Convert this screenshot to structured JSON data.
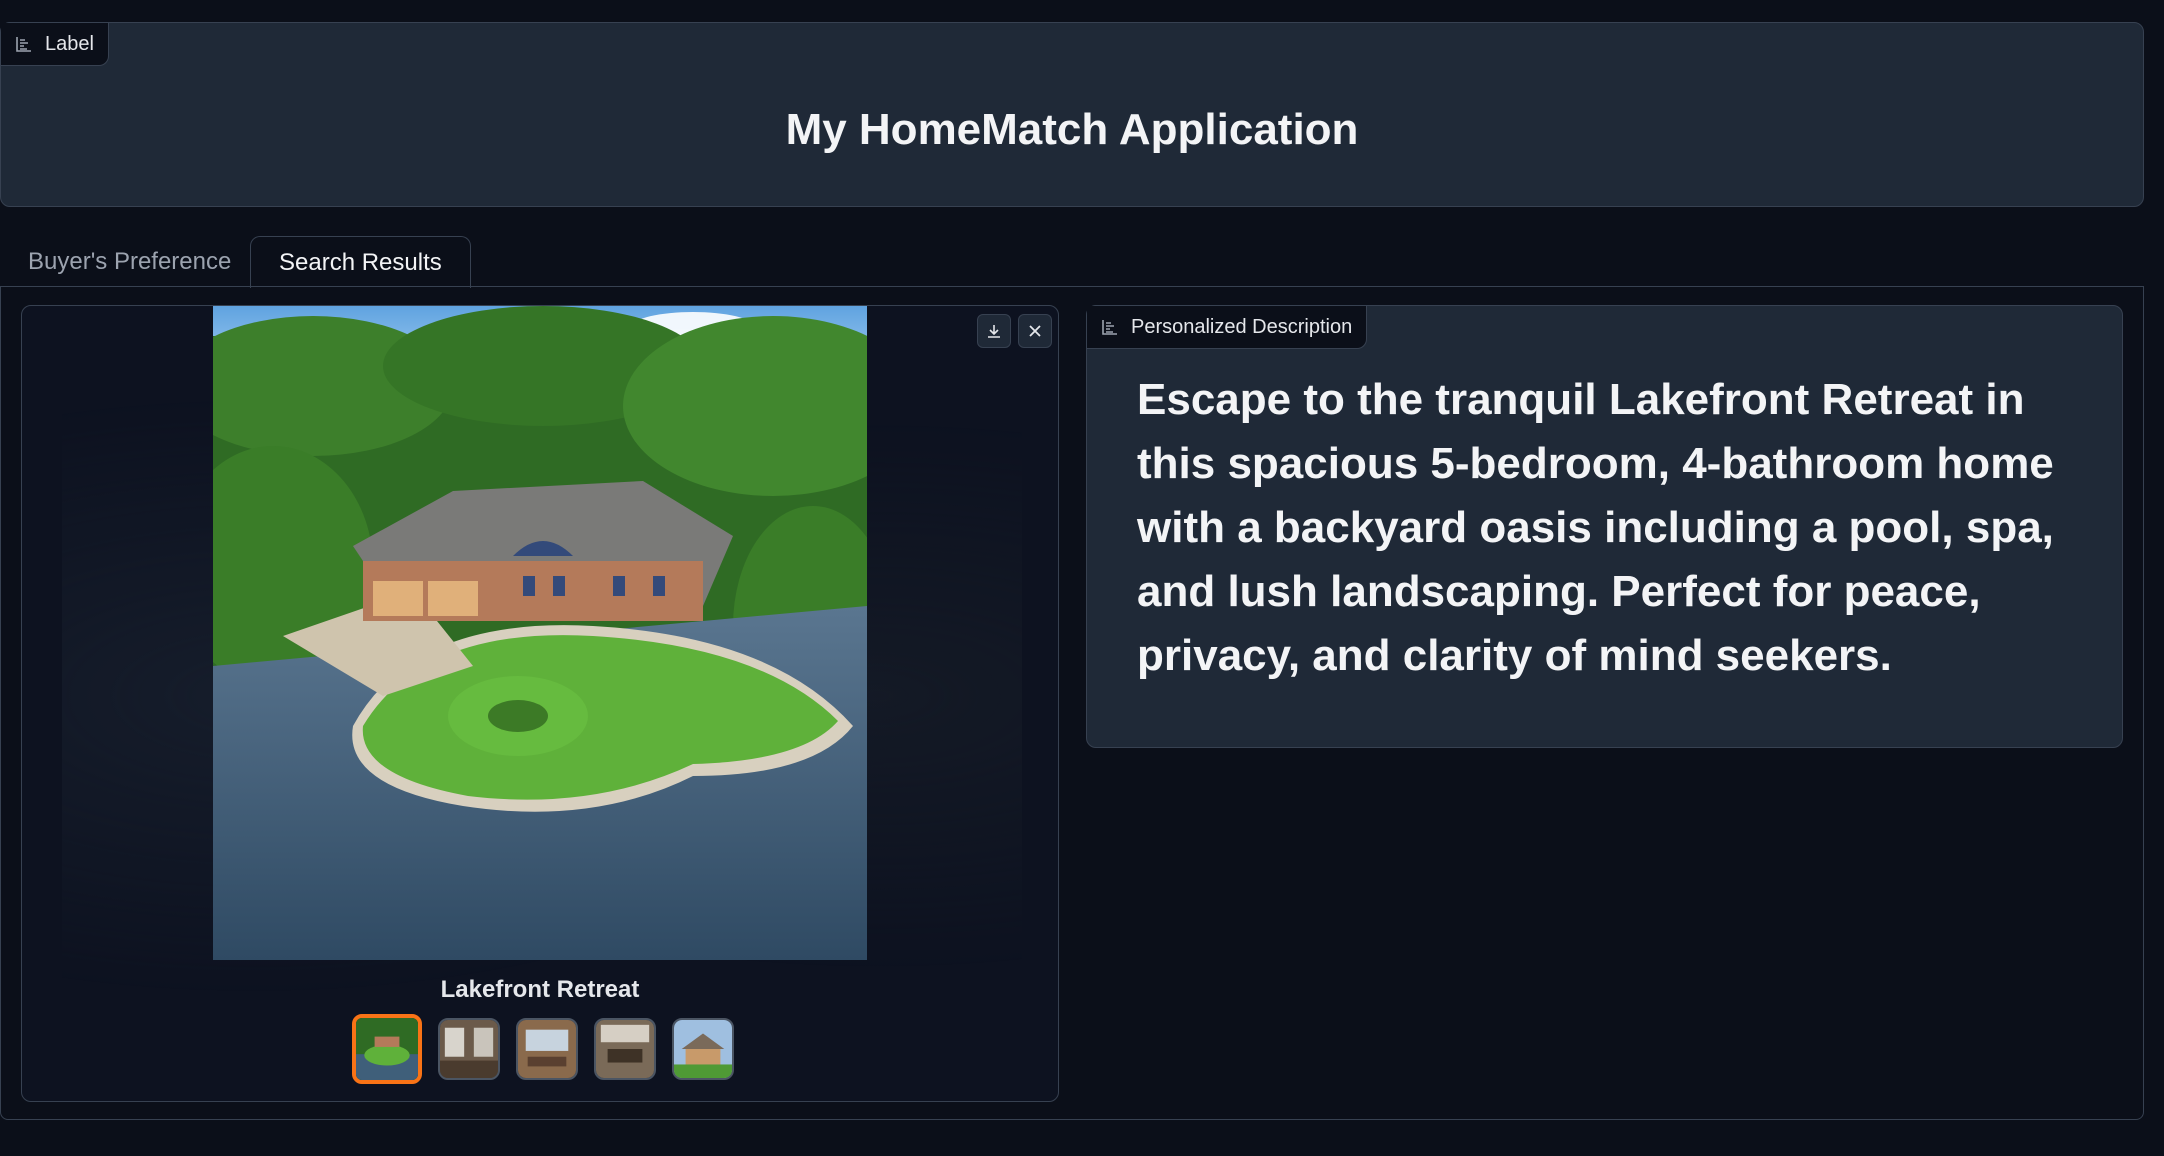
{
  "header": {
    "tag_label": "Label",
    "title": "My HomeMatch Application"
  },
  "tabs": [
    {
      "label": "Buyer's Preference",
      "active": false
    },
    {
      "label": "Search Results",
      "active": true
    }
  ],
  "gallery": {
    "caption": "Lakefront Retreat",
    "download_icon": "download-icon",
    "close_icon": "close-icon",
    "thumbnails": [
      "Lakefront Retreat exterior",
      "interior 1",
      "interior 2",
      "interior 3",
      "exterior 2"
    ],
    "selected_index": 0
  },
  "description": {
    "tag_label": "Personalized Description",
    "text": "Escape to the tranquil Lakefront Retreat in this spacious 5-bedroom, 4-bathroom home with a backyard oasis including a pool, spa, and lush landscaping. Perfect for peace, privacy, and clarity of mind seekers."
  },
  "colors": {
    "background": "#0b0f19",
    "panel": "#1f2937",
    "accent": "#f97316"
  }
}
